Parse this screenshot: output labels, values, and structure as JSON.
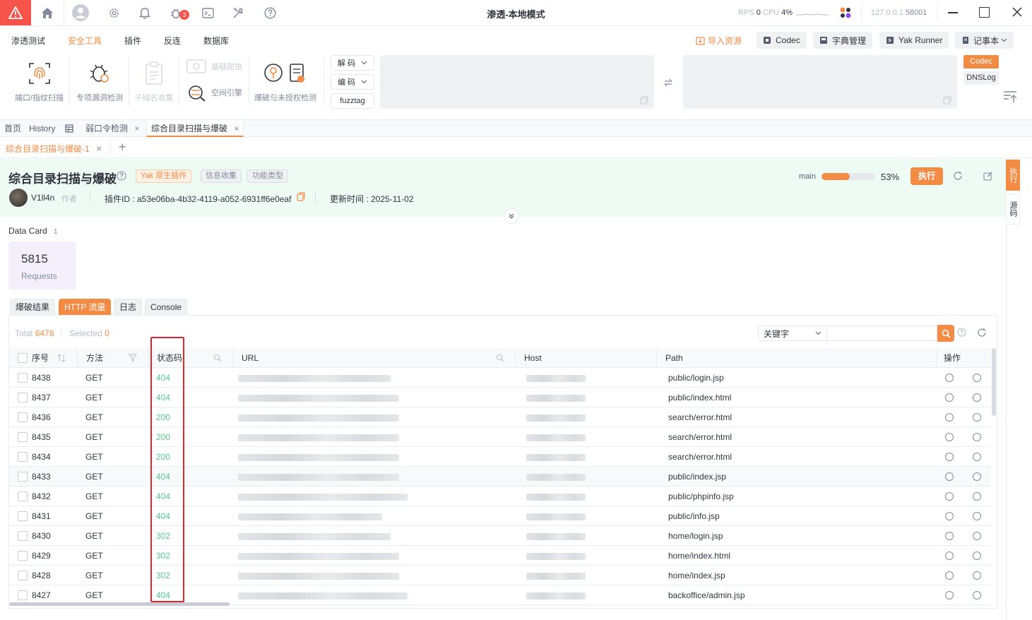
{
  "titlebar": {
    "title": "渗透-本地模式",
    "rps_label": "RPS",
    "rps_value": "0",
    "cpu_label": "CPU",
    "cpu_value": "4%",
    "address": "127.0.0.1",
    "port": "58001",
    "badge_count": "3"
  },
  "menu": {
    "items": [
      "渗透测试",
      "安全工具",
      "插件",
      "反连",
      "数据库"
    ],
    "active": "安全工具",
    "import_label": "导入资源",
    "codec_label": "Codec",
    "dict_label": "字典管理",
    "runner_label": "Yak Runner",
    "notes_label": "记事本"
  },
  "tools": {
    "port_scan": "端口/指纹扫描",
    "vuln_scan": "专项漏洞检测",
    "subdomain": "子域名收集",
    "crawler": "基础爬虫",
    "space_engine": "空间引擎",
    "brute": "爆破与未授权检测",
    "decode": "解 码",
    "encode": "编 码",
    "fuzztag": "fuzztag",
    "codec_tag": "Codec",
    "dnslog_tag": "DNSLog"
  },
  "page_tabs": {
    "home": "首页",
    "history": "History",
    "weak_pwd": "弱口令检测",
    "dir_scan": "综合目录扫描与爆破"
  },
  "sub_tab": {
    "label": "综合目录扫描与爆破-1"
  },
  "plugin": {
    "name": "综合目录扫描与爆破",
    "tag_native": "Yak 原生插件",
    "tag_info": "信息收集",
    "tag_type": "功能类型",
    "author": "V1ll4n",
    "author_role": "作者",
    "id_label": "插件ID : a53e06ba-4b32-4119-a052-6931ff6e0eaf",
    "updated_label": "更新时间 : 2025-11-02",
    "branch": "main",
    "progress": 0.53,
    "progress_text": "53%",
    "run_label": "执行",
    "side_run": "执行",
    "side_source": "源码"
  },
  "data_card": {
    "title": "Data Card",
    "count": "1",
    "value": "5815",
    "label": "Requests"
  },
  "result_tabs": [
    "爆破结果",
    "HTTP 流量",
    "日志",
    "Console"
  ],
  "result_tab_active": "HTTP 流量",
  "summary": {
    "total_label": "Total",
    "total_value": "6478",
    "selected_label": "Selected",
    "selected_value": "0",
    "filter_select": "关键字"
  },
  "columns": {
    "index": "序号",
    "method": "方法",
    "status": "状态码",
    "url": "URL",
    "host": "Host",
    "path": "Path",
    "ops": "操作"
  },
  "rows": [
    {
      "id": "8438",
      "method": "GET",
      "status": "404",
      "path": "public/login.jsp"
    },
    {
      "id": "8437",
      "method": "GET",
      "status": "404",
      "path": "public/index.html"
    },
    {
      "id": "8436",
      "method": "GET",
      "status": "200",
      "path": "search/error.html"
    },
    {
      "id": "8435",
      "method": "GET",
      "status": "200",
      "path": "search/error.html"
    },
    {
      "id": "8434",
      "method": "GET",
      "status": "200",
      "path": "search/error.html"
    },
    {
      "id": "8433",
      "method": "GET",
      "status": "404",
      "path": "public/index.jsp"
    },
    {
      "id": "8432",
      "method": "GET",
      "status": "404",
      "path": "public/phpinfo.jsp"
    },
    {
      "id": "8431",
      "method": "GET",
      "status": "404",
      "path": "public/info.jsp"
    },
    {
      "id": "8430",
      "method": "GET",
      "status": "302",
      "path": "home/login.jsp"
    },
    {
      "id": "8429",
      "method": "GET",
      "status": "302",
      "path": "home/index.html"
    },
    {
      "id": "8428",
      "method": "GET",
      "status": "302",
      "path": "home/index.jsp"
    },
    {
      "id": "8427",
      "method": "GET",
      "status": "404",
      "path": "backoffice/admin.jsp"
    }
  ],
  "colors": {
    "accent": "#f28b44",
    "status_green": "#56c991",
    "highlight_red": "#e0252d",
    "danger": "#f6544a"
  }
}
